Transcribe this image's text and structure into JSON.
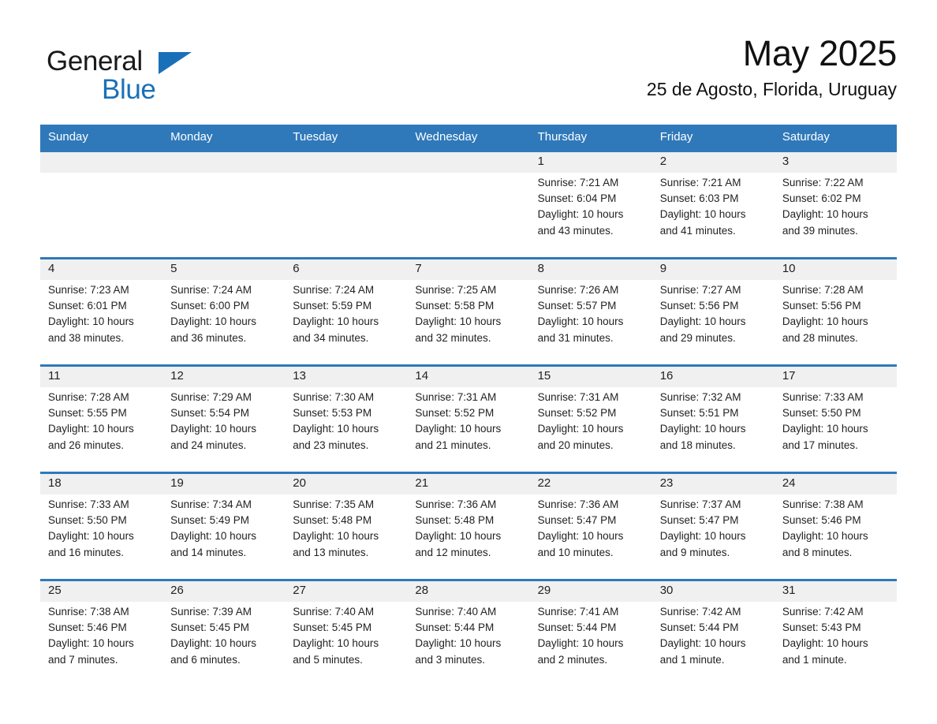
{
  "brand": {
    "name_part1": "General",
    "name_part2": "Blue",
    "triangle_color": "#1a70b8"
  },
  "header": {
    "month_title": "May 2025",
    "location": "25 de Agosto, Florida, Uruguay"
  },
  "theme": {
    "header_blue": "#2f79ba",
    "date_band_gray": "#f0f0f0",
    "text_color": "#222222"
  },
  "weekday_headers": [
    "Sunday",
    "Monday",
    "Tuesday",
    "Wednesday",
    "Thursday",
    "Friday",
    "Saturday"
  ],
  "weeks": [
    {
      "days": [
        {
          "date": "",
          "sunrise": "",
          "sunset": "",
          "daylight_line1": "",
          "daylight_line2": ""
        },
        {
          "date": "",
          "sunrise": "",
          "sunset": "",
          "daylight_line1": "",
          "daylight_line2": ""
        },
        {
          "date": "",
          "sunrise": "",
          "sunset": "",
          "daylight_line1": "",
          "daylight_line2": ""
        },
        {
          "date": "",
          "sunrise": "",
          "sunset": "",
          "daylight_line1": "",
          "daylight_line2": ""
        },
        {
          "date": "1",
          "sunrise": "Sunrise: 7:21 AM",
          "sunset": "Sunset: 6:04 PM",
          "daylight_line1": "Daylight: 10 hours",
          "daylight_line2": "and 43 minutes."
        },
        {
          "date": "2",
          "sunrise": "Sunrise: 7:21 AM",
          "sunset": "Sunset: 6:03 PM",
          "daylight_line1": "Daylight: 10 hours",
          "daylight_line2": "and 41 minutes."
        },
        {
          "date": "3",
          "sunrise": "Sunrise: 7:22 AM",
          "sunset": "Sunset: 6:02 PM",
          "daylight_line1": "Daylight: 10 hours",
          "daylight_line2": "and 39 minutes."
        }
      ]
    },
    {
      "days": [
        {
          "date": "4",
          "sunrise": "Sunrise: 7:23 AM",
          "sunset": "Sunset: 6:01 PM",
          "daylight_line1": "Daylight: 10 hours",
          "daylight_line2": "and 38 minutes."
        },
        {
          "date": "5",
          "sunrise": "Sunrise: 7:24 AM",
          "sunset": "Sunset: 6:00 PM",
          "daylight_line1": "Daylight: 10 hours",
          "daylight_line2": "and 36 minutes."
        },
        {
          "date": "6",
          "sunrise": "Sunrise: 7:24 AM",
          "sunset": "Sunset: 5:59 PM",
          "daylight_line1": "Daylight: 10 hours",
          "daylight_line2": "and 34 minutes."
        },
        {
          "date": "7",
          "sunrise": "Sunrise: 7:25 AM",
          "sunset": "Sunset: 5:58 PM",
          "daylight_line1": "Daylight: 10 hours",
          "daylight_line2": "and 32 minutes."
        },
        {
          "date": "8",
          "sunrise": "Sunrise: 7:26 AM",
          "sunset": "Sunset: 5:57 PM",
          "daylight_line1": "Daylight: 10 hours",
          "daylight_line2": "and 31 minutes."
        },
        {
          "date": "9",
          "sunrise": "Sunrise: 7:27 AM",
          "sunset": "Sunset: 5:56 PM",
          "daylight_line1": "Daylight: 10 hours",
          "daylight_line2": "and 29 minutes."
        },
        {
          "date": "10",
          "sunrise": "Sunrise: 7:28 AM",
          "sunset": "Sunset: 5:56 PM",
          "daylight_line1": "Daylight: 10 hours",
          "daylight_line2": "and 28 minutes."
        }
      ]
    },
    {
      "days": [
        {
          "date": "11",
          "sunrise": "Sunrise: 7:28 AM",
          "sunset": "Sunset: 5:55 PM",
          "daylight_line1": "Daylight: 10 hours",
          "daylight_line2": "and 26 minutes."
        },
        {
          "date": "12",
          "sunrise": "Sunrise: 7:29 AM",
          "sunset": "Sunset: 5:54 PM",
          "daylight_line1": "Daylight: 10 hours",
          "daylight_line2": "and 24 minutes."
        },
        {
          "date": "13",
          "sunrise": "Sunrise: 7:30 AM",
          "sunset": "Sunset: 5:53 PM",
          "daylight_line1": "Daylight: 10 hours",
          "daylight_line2": "and 23 minutes."
        },
        {
          "date": "14",
          "sunrise": "Sunrise: 7:31 AM",
          "sunset": "Sunset: 5:52 PM",
          "daylight_line1": "Daylight: 10 hours",
          "daylight_line2": "and 21 minutes."
        },
        {
          "date": "15",
          "sunrise": "Sunrise: 7:31 AM",
          "sunset": "Sunset: 5:52 PM",
          "daylight_line1": "Daylight: 10 hours",
          "daylight_line2": "and 20 minutes."
        },
        {
          "date": "16",
          "sunrise": "Sunrise: 7:32 AM",
          "sunset": "Sunset: 5:51 PM",
          "daylight_line1": "Daylight: 10 hours",
          "daylight_line2": "and 18 minutes."
        },
        {
          "date": "17",
          "sunrise": "Sunrise: 7:33 AM",
          "sunset": "Sunset: 5:50 PM",
          "daylight_line1": "Daylight: 10 hours",
          "daylight_line2": "and 17 minutes."
        }
      ]
    },
    {
      "days": [
        {
          "date": "18",
          "sunrise": "Sunrise: 7:33 AM",
          "sunset": "Sunset: 5:50 PM",
          "daylight_line1": "Daylight: 10 hours",
          "daylight_line2": "and 16 minutes."
        },
        {
          "date": "19",
          "sunrise": "Sunrise: 7:34 AM",
          "sunset": "Sunset: 5:49 PM",
          "daylight_line1": "Daylight: 10 hours",
          "daylight_line2": "and 14 minutes."
        },
        {
          "date": "20",
          "sunrise": "Sunrise: 7:35 AM",
          "sunset": "Sunset: 5:48 PM",
          "daylight_line1": "Daylight: 10 hours",
          "daylight_line2": "and 13 minutes."
        },
        {
          "date": "21",
          "sunrise": "Sunrise: 7:36 AM",
          "sunset": "Sunset: 5:48 PM",
          "daylight_line1": "Daylight: 10 hours",
          "daylight_line2": "and 12 minutes."
        },
        {
          "date": "22",
          "sunrise": "Sunrise: 7:36 AM",
          "sunset": "Sunset: 5:47 PM",
          "daylight_line1": "Daylight: 10 hours",
          "daylight_line2": "and 10 minutes."
        },
        {
          "date": "23",
          "sunrise": "Sunrise: 7:37 AM",
          "sunset": "Sunset: 5:47 PM",
          "daylight_line1": "Daylight: 10 hours",
          "daylight_line2": "and 9 minutes."
        },
        {
          "date": "24",
          "sunrise": "Sunrise: 7:38 AM",
          "sunset": "Sunset: 5:46 PM",
          "daylight_line1": "Daylight: 10 hours",
          "daylight_line2": "and 8 minutes."
        }
      ]
    },
    {
      "days": [
        {
          "date": "25",
          "sunrise": "Sunrise: 7:38 AM",
          "sunset": "Sunset: 5:46 PM",
          "daylight_line1": "Daylight: 10 hours",
          "daylight_line2": "and 7 minutes."
        },
        {
          "date": "26",
          "sunrise": "Sunrise: 7:39 AM",
          "sunset": "Sunset: 5:45 PM",
          "daylight_line1": "Daylight: 10 hours",
          "daylight_line2": "and 6 minutes."
        },
        {
          "date": "27",
          "sunrise": "Sunrise: 7:40 AM",
          "sunset": "Sunset: 5:45 PM",
          "daylight_line1": "Daylight: 10 hours",
          "daylight_line2": "and 5 minutes."
        },
        {
          "date": "28",
          "sunrise": "Sunrise: 7:40 AM",
          "sunset": "Sunset: 5:44 PM",
          "daylight_line1": "Daylight: 10 hours",
          "daylight_line2": "and 3 minutes."
        },
        {
          "date": "29",
          "sunrise": "Sunrise: 7:41 AM",
          "sunset": "Sunset: 5:44 PM",
          "daylight_line1": "Daylight: 10 hours",
          "daylight_line2": "and 2 minutes."
        },
        {
          "date": "30",
          "sunrise": "Sunrise: 7:42 AM",
          "sunset": "Sunset: 5:44 PM",
          "daylight_line1": "Daylight: 10 hours",
          "daylight_line2": "and 1 minute."
        },
        {
          "date": "31",
          "sunrise": "Sunrise: 7:42 AM",
          "sunset": "Sunset: 5:43 PM",
          "daylight_line1": "Daylight: 10 hours",
          "daylight_line2": "and 1 minute."
        }
      ]
    }
  ]
}
